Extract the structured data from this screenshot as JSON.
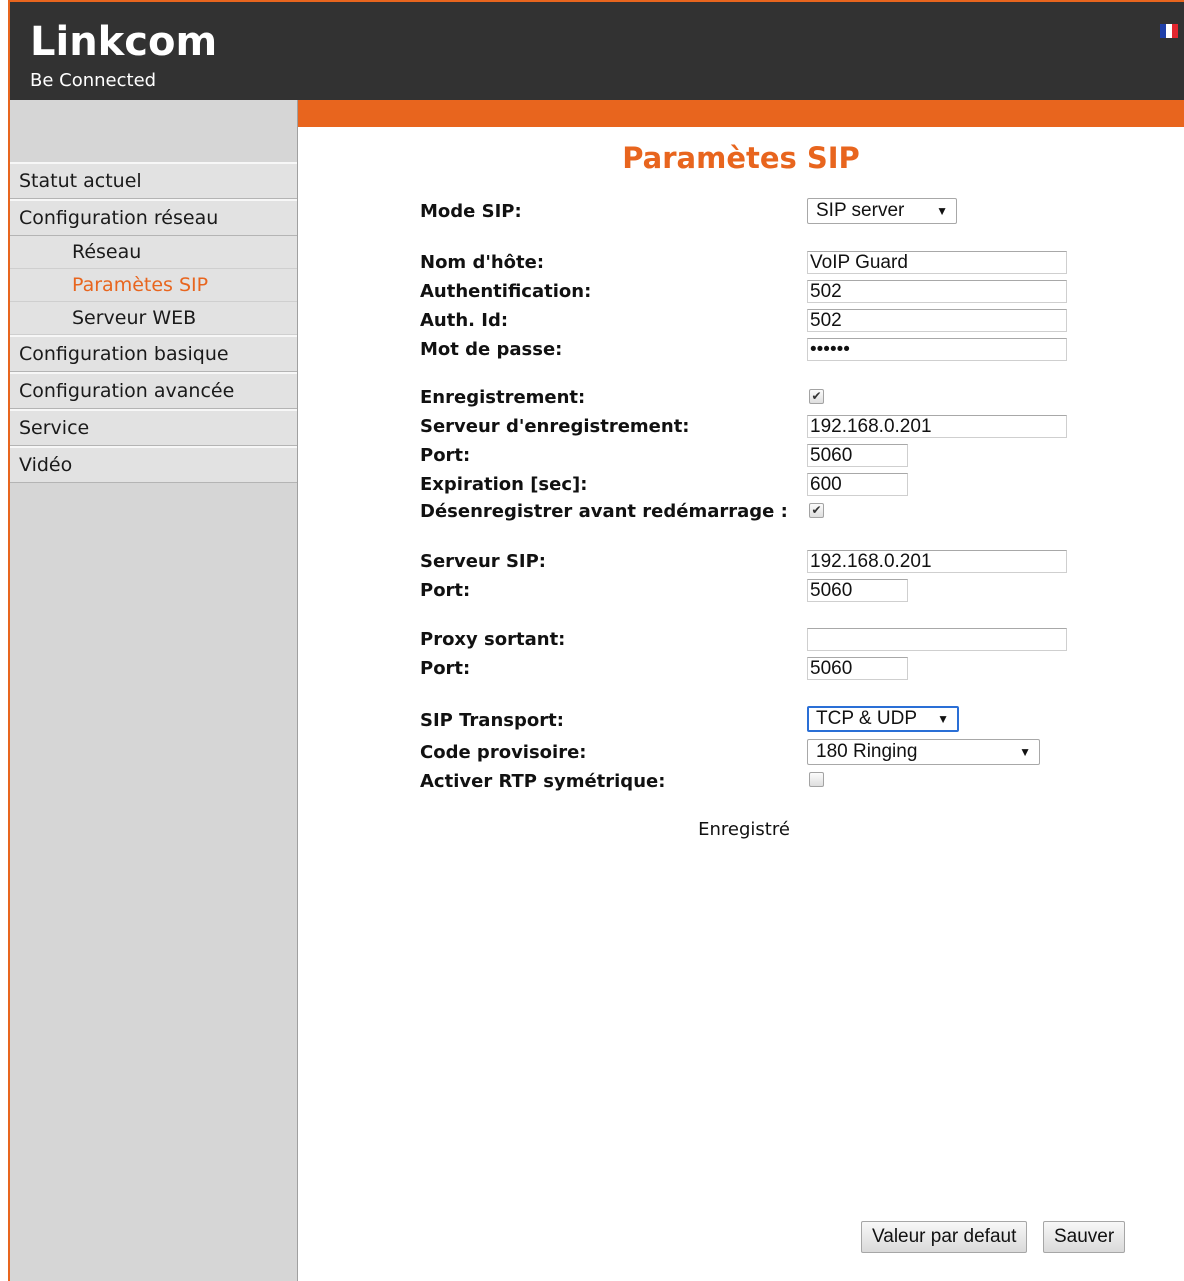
{
  "header": {
    "brand": "Linkcom",
    "tagline": "Be Connected",
    "language_flag": "french-flag-icon",
    "colors": {
      "background": "#323232",
      "accent": "#e8651e"
    }
  },
  "menu": {
    "items": [
      {
        "label": "Statut actuel"
      },
      {
        "label": "Configuration réseau"
      },
      {
        "label": "Configuration basique"
      },
      {
        "label": "Configuration avancée"
      },
      {
        "label": "Service"
      },
      {
        "label": "Vidéo"
      }
    ],
    "subitems": [
      {
        "label": "Réseau"
      },
      {
        "label": "Paramètes SIP",
        "active": true
      },
      {
        "label": "Serveur WEB"
      }
    ]
  },
  "page": {
    "title": "Paramètes SIP"
  },
  "form": {
    "mode_sip": {
      "label": "Mode SIP:",
      "value": "SIP server"
    },
    "hostname": {
      "label": "Nom d'hôte:",
      "value": "VoIP Guard"
    },
    "authentication": {
      "label": "Authentification:",
      "value": "502"
    },
    "auth_id": {
      "label": "Auth. Id:",
      "value": "502"
    },
    "password": {
      "label": "Mot de passe:",
      "value": "502502"
    },
    "registration": {
      "label": "Enregistrement:",
      "checked": true
    },
    "registrar": {
      "label": "Serveur d'enregistrement:",
      "value": "192.168.0.201"
    },
    "registrar_port": {
      "label": "Port:",
      "value": "5060"
    },
    "expiration": {
      "label": "Expiration [sec]:",
      "value": "600"
    },
    "unregister_reboot": {
      "label": "Désenregistrer avant redémarrage :",
      "checked": true
    },
    "sip_server": {
      "label": "Serveur SIP:",
      "value": "192.168.0.201"
    },
    "sip_server_port": {
      "label": "Port:",
      "value": "5060"
    },
    "outbound_proxy": {
      "label": "Proxy sortant:",
      "value": ""
    },
    "outbound_proxy_port": {
      "label": "Port:",
      "value": "5060"
    },
    "transport": {
      "label": "SIP Transport:",
      "value": "TCP & UDP"
    },
    "provisional_code": {
      "label": "Code provisoire:",
      "value": "180 Ringing"
    },
    "symmetric_rtp": {
      "label": "Activer RTP symétrique:",
      "checked": false
    }
  },
  "status": {
    "text": "Enregistré"
  },
  "buttons": {
    "default_label": "Valeur par defaut",
    "save_label": "Sauver"
  },
  "icons": {
    "checkmark": "✔",
    "dropdown_arrow": "▼"
  }
}
